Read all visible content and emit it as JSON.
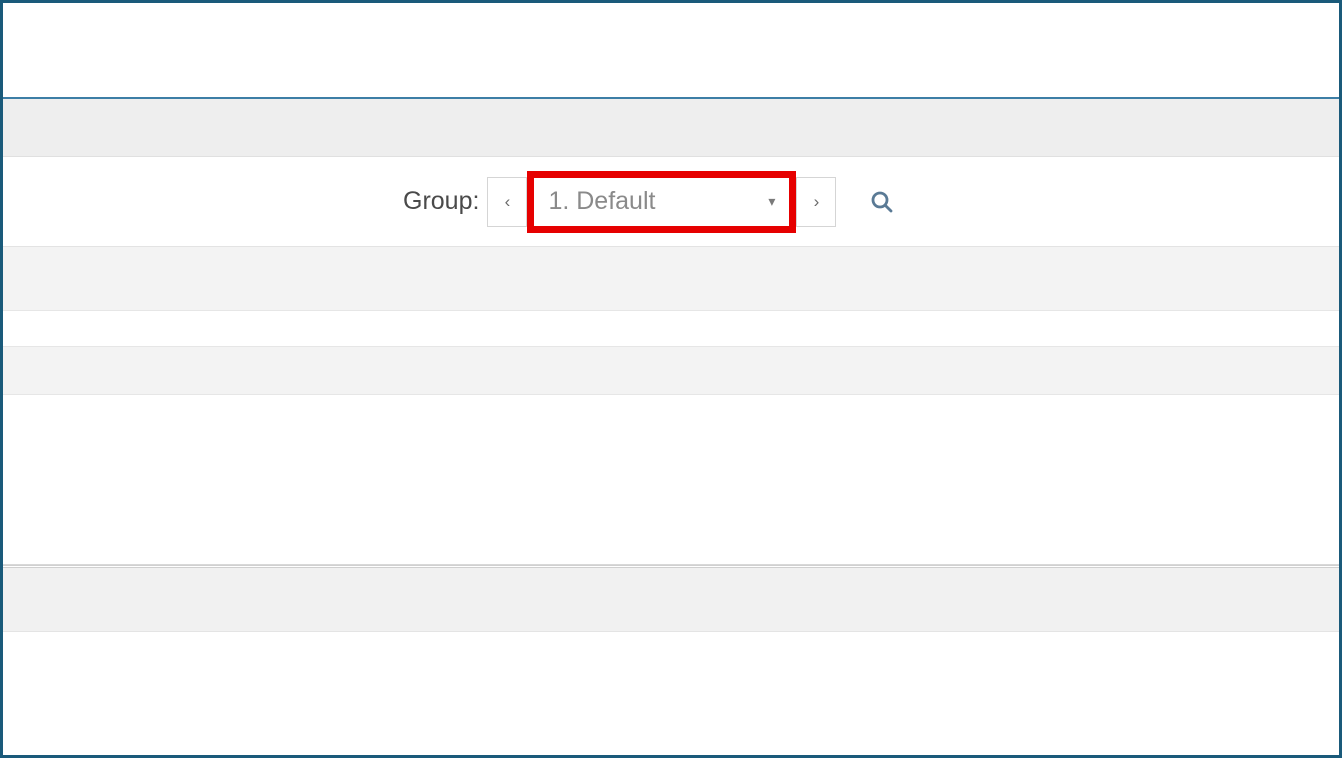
{
  "group_selector": {
    "label": "Group:",
    "selected": "1. Default"
  },
  "icons": {
    "prev": "‹",
    "next": "›",
    "caret": "▾"
  },
  "highlight_color": "#e60000"
}
